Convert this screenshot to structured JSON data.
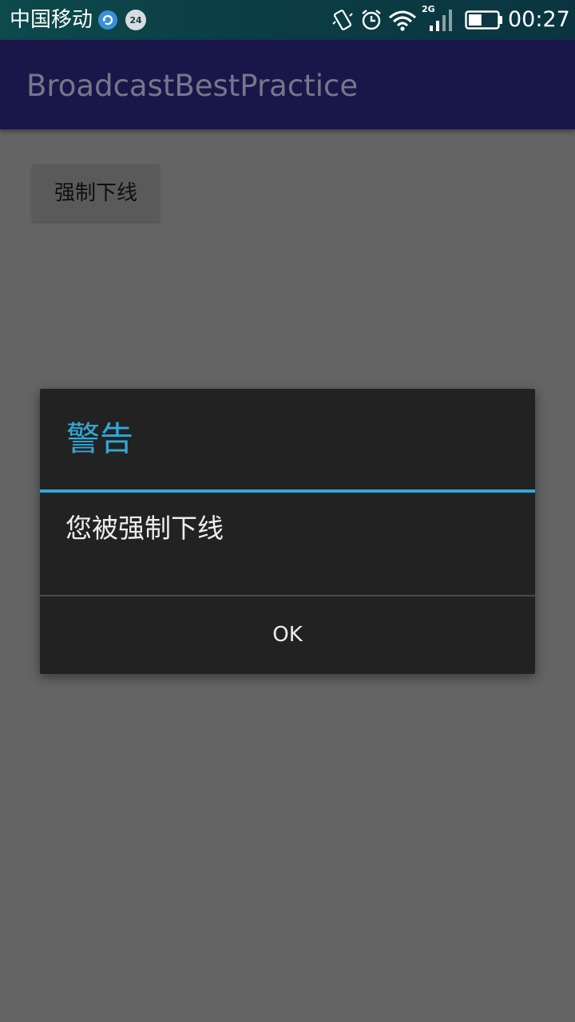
{
  "status_bar": {
    "carrier": "中国移动",
    "network_type": "2G",
    "time": "00:27",
    "badge_text": "24",
    "battery_level": 0.45,
    "icons": [
      "sync-icon",
      "badge-24-icon",
      "vibrate-icon",
      "alarm-icon",
      "wifi-icon",
      "signal-icon",
      "battery-icon"
    ]
  },
  "app_bar": {
    "title": "BroadcastBestPractice",
    "color": "#19174a"
  },
  "main": {
    "force_offline_label": "强制下线"
  },
  "dialog": {
    "title": "警告",
    "message": "您被强制下线",
    "ok_label": "OK",
    "accent_color": "#32a8d6"
  }
}
